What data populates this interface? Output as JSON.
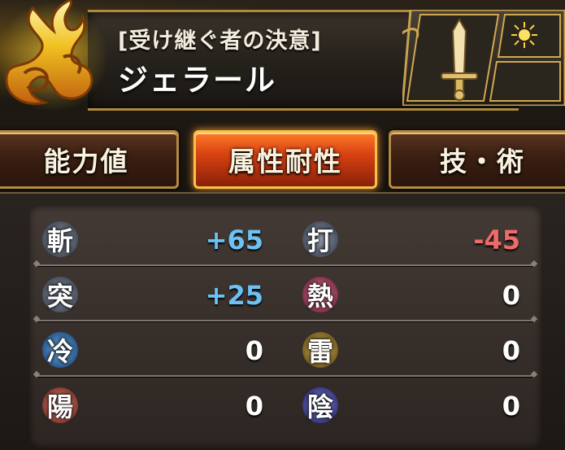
{
  "character": {
    "title": "[受け継ぐ者の決意]",
    "name": "ジェラール",
    "weapon_icon": "sword-icon",
    "element_icon": "sun-burst-icon"
  },
  "tabs": [
    {
      "label": "能力値",
      "active": false
    },
    {
      "label": "属性耐性",
      "active": true
    },
    {
      "label": "技・術",
      "active": false
    }
  ],
  "resistances": [
    {
      "left": {
        "glyph": "斬",
        "icon": "slash-icon",
        "value": "+65",
        "color": "#6cc2f5"
      },
      "right": {
        "glyph": "打",
        "icon": "blunt-icon",
        "value": "-45",
        "color": "#ef6a6a"
      }
    },
    {
      "left": {
        "glyph": "突",
        "icon": "pierce-icon",
        "value": "+25",
        "color": "#6cc2f5"
      },
      "right": {
        "glyph": "熱",
        "icon": "heat-icon",
        "value": "0",
        "color": "#ffffff"
      }
    },
    {
      "left": {
        "glyph": "冷",
        "icon": "cold-icon",
        "value": "0",
        "color": "#ffffff"
      },
      "right": {
        "glyph": "雷",
        "icon": "thunder-icon",
        "value": "0",
        "color": "#ffffff"
      }
    },
    {
      "left": {
        "glyph": "陽",
        "icon": "light-icon",
        "value": "0",
        "color": "#ffffff"
      },
      "right": {
        "glyph": "陰",
        "icon": "dark-icon",
        "value": "0",
        "color": "#ffffff"
      }
    }
  ],
  "colors": {
    "positive": "#6cc2f5",
    "negative": "#ef6a6a",
    "neutral": "#ffffff",
    "active_tab": "#e0521a",
    "gold_border": "#b38a40"
  }
}
